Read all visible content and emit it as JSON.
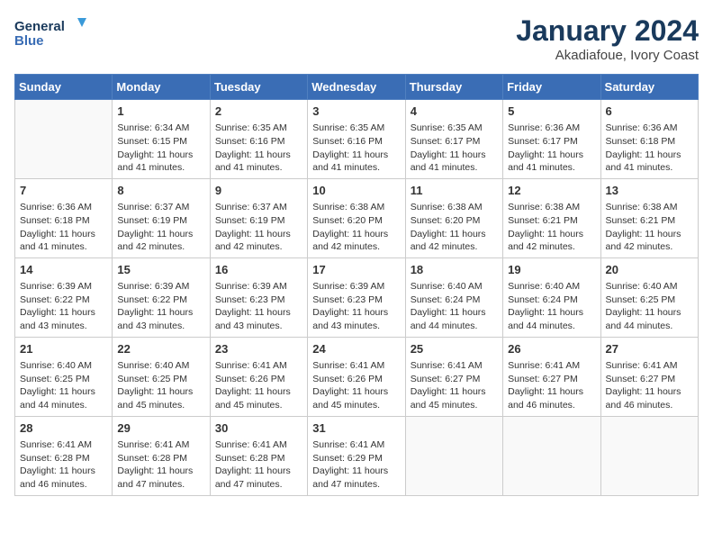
{
  "logo": {
    "line1": "General",
    "line2": "Blue"
  },
  "title": "January 2024",
  "subtitle": "Akadiafoue, Ivory Coast",
  "days_of_week": [
    "Sunday",
    "Monday",
    "Tuesday",
    "Wednesday",
    "Thursday",
    "Friday",
    "Saturday"
  ],
  "weeks": [
    [
      {
        "day": "",
        "sunrise": "",
        "sunset": "",
        "daylight": ""
      },
      {
        "day": "1",
        "sunrise": "Sunrise: 6:34 AM",
        "sunset": "Sunset: 6:15 PM",
        "daylight": "Daylight: 11 hours and 41 minutes."
      },
      {
        "day": "2",
        "sunrise": "Sunrise: 6:35 AM",
        "sunset": "Sunset: 6:16 PM",
        "daylight": "Daylight: 11 hours and 41 minutes."
      },
      {
        "day": "3",
        "sunrise": "Sunrise: 6:35 AM",
        "sunset": "Sunset: 6:16 PM",
        "daylight": "Daylight: 11 hours and 41 minutes."
      },
      {
        "day": "4",
        "sunrise": "Sunrise: 6:35 AM",
        "sunset": "Sunset: 6:17 PM",
        "daylight": "Daylight: 11 hours and 41 minutes."
      },
      {
        "day": "5",
        "sunrise": "Sunrise: 6:36 AM",
        "sunset": "Sunset: 6:17 PM",
        "daylight": "Daylight: 11 hours and 41 minutes."
      },
      {
        "day": "6",
        "sunrise": "Sunrise: 6:36 AM",
        "sunset": "Sunset: 6:18 PM",
        "daylight": "Daylight: 11 hours and 41 minutes."
      }
    ],
    [
      {
        "day": "7",
        "sunrise": "Sunrise: 6:36 AM",
        "sunset": "Sunset: 6:18 PM",
        "daylight": "Daylight: 11 hours and 41 minutes."
      },
      {
        "day": "8",
        "sunrise": "Sunrise: 6:37 AM",
        "sunset": "Sunset: 6:19 PM",
        "daylight": "Daylight: 11 hours and 42 minutes."
      },
      {
        "day": "9",
        "sunrise": "Sunrise: 6:37 AM",
        "sunset": "Sunset: 6:19 PM",
        "daylight": "Daylight: 11 hours and 42 minutes."
      },
      {
        "day": "10",
        "sunrise": "Sunrise: 6:38 AM",
        "sunset": "Sunset: 6:20 PM",
        "daylight": "Daylight: 11 hours and 42 minutes."
      },
      {
        "day": "11",
        "sunrise": "Sunrise: 6:38 AM",
        "sunset": "Sunset: 6:20 PM",
        "daylight": "Daylight: 11 hours and 42 minutes."
      },
      {
        "day": "12",
        "sunrise": "Sunrise: 6:38 AM",
        "sunset": "Sunset: 6:21 PM",
        "daylight": "Daylight: 11 hours and 42 minutes."
      },
      {
        "day": "13",
        "sunrise": "Sunrise: 6:38 AM",
        "sunset": "Sunset: 6:21 PM",
        "daylight": "Daylight: 11 hours and 42 minutes."
      }
    ],
    [
      {
        "day": "14",
        "sunrise": "Sunrise: 6:39 AM",
        "sunset": "Sunset: 6:22 PM",
        "daylight": "Daylight: 11 hours and 43 minutes."
      },
      {
        "day": "15",
        "sunrise": "Sunrise: 6:39 AM",
        "sunset": "Sunset: 6:22 PM",
        "daylight": "Daylight: 11 hours and 43 minutes."
      },
      {
        "day": "16",
        "sunrise": "Sunrise: 6:39 AM",
        "sunset": "Sunset: 6:23 PM",
        "daylight": "Daylight: 11 hours and 43 minutes."
      },
      {
        "day": "17",
        "sunrise": "Sunrise: 6:39 AM",
        "sunset": "Sunset: 6:23 PM",
        "daylight": "Daylight: 11 hours and 43 minutes."
      },
      {
        "day": "18",
        "sunrise": "Sunrise: 6:40 AM",
        "sunset": "Sunset: 6:24 PM",
        "daylight": "Daylight: 11 hours and 44 minutes."
      },
      {
        "day": "19",
        "sunrise": "Sunrise: 6:40 AM",
        "sunset": "Sunset: 6:24 PM",
        "daylight": "Daylight: 11 hours and 44 minutes."
      },
      {
        "day": "20",
        "sunrise": "Sunrise: 6:40 AM",
        "sunset": "Sunset: 6:25 PM",
        "daylight": "Daylight: 11 hours and 44 minutes."
      }
    ],
    [
      {
        "day": "21",
        "sunrise": "Sunrise: 6:40 AM",
        "sunset": "Sunset: 6:25 PM",
        "daylight": "Daylight: 11 hours and 44 minutes."
      },
      {
        "day": "22",
        "sunrise": "Sunrise: 6:40 AM",
        "sunset": "Sunset: 6:25 PM",
        "daylight": "Daylight: 11 hours and 45 minutes."
      },
      {
        "day": "23",
        "sunrise": "Sunrise: 6:41 AM",
        "sunset": "Sunset: 6:26 PM",
        "daylight": "Daylight: 11 hours and 45 minutes."
      },
      {
        "day": "24",
        "sunrise": "Sunrise: 6:41 AM",
        "sunset": "Sunset: 6:26 PM",
        "daylight": "Daylight: 11 hours and 45 minutes."
      },
      {
        "day": "25",
        "sunrise": "Sunrise: 6:41 AM",
        "sunset": "Sunset: 6:27 PM",
        "daylight": "Daylight: 11 hours and 45 minutes."
      },
      {
        "day": "26",
        "sunrise": "Sunrise: 6:41 AM",
        "sunset": "Sunset: 6:27 PM",
        "daylight": "Daylight: 11 hours and 46 minutes."
      },
      {
        "day": "27",
        "sunrise": "Sunrise: 6:41 AM",
        "sunset": "Sunset: 6:27 PM",
        "daylight": "Daylight: 11 hours and 46 minutes."
      }
    ],
    [
      {
        "day": "28",
        "sunrise": "Sunrise: 6:41 AM",
        "sunset": "Sunset: 6:28 PM",
        "daylight": "Daylight: 11 hours and 46 minutes."
      },
      {
        "day": "29",
        "sunrise": "Sunrise: 6:41 AM",
        "sunset": "Sunset: 6:28 PM",
        "daylight": "Daylight: 11 hours and 47 minutes."
      },
      {
        "day": "30",
        "sunrise": "Sunrise: 6:41 AM",
        "sunset": "Sunset: 6:28 PM",
        "daylight": "Daylight: 11 hours and 47 minutes."
      },
      {
        "day": "31",
        "sunrise": "Sunrise: 6:41 AM",
        "sunset": "Sunset: 6:29 PM",
        "daylight": "Daylight: 11 hours and 47 minutes."
      },
      {
        "day": "",
        "sunrise": "",
        "sunset": "",
        "daylight": ""
      },
      {
        "day": "",
        "sunrise": "",
        "sunset": "",
        "daylight": ""
      },
      {
        "day": "",
        "sunrise": "",
        "sunset": "",
        "daylight": ""
      }
    ]
  ]
}
